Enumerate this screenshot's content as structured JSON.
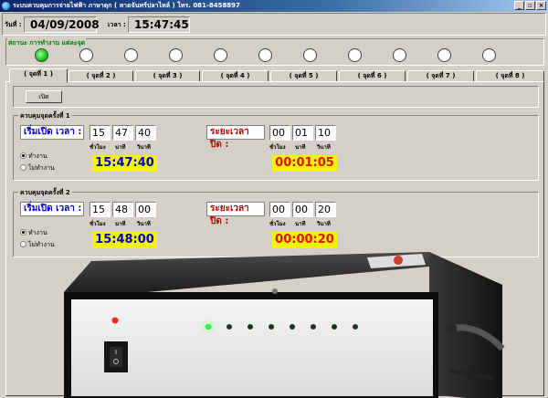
{
  "window": {
    "title": "ระบบควบคุมการจ่ายไฟฟ้า ภาษาดุก ( หาดจันทร์ปลาไหล์ ) โทร. 081-8458897",
    "buttons": [
      "_",
      "▫",
      "×"
    ]
  },
  "topbar": {
    "date_label": "วันที่ :",
    "date_value": "04/09/2008",
    "time_label": "เวลา :",
    "time_value": "15:47:45"
  },
  "status": {
    "title": "สถานะ การทำงาน แต่ละจุด",
    "leds": [
      {
        "on": true
      },
      {
        "on": false
      },
      {
        "on": false
      },
      {
        "on": false
      },
      {
        "on": false
      },
      {
        "on": false
      },
      {
        "on": false
      },
      {
        "on": false
      },
      {
        "on": false
      },
      {
        "on": false
      },
      {
        "on": false
      }
    ]
  },
  "tabs": [
    "( จุดที่ 1 )",
    "( จุดที่ 2 )",
    "( จุดที่ 3 )",
    "( จุดที่ 4 )",
    "( จุดที่ 5 )",
    "( จุดที่ 6 )",
    "( จุดที่ 7 )",
    "( จุดที่ 8 )"
  ],
  "open_button": "เปิด",
  "groups": [
    {
      "title": "ควบคุมจุดครั้งที่ 1",
      "start_caption": "เริ่มเปิด เวลา :",
      "start": {
        "h": "15",
        "m": "47",
        "s": "40"
      },
      "duration_caption": "ระยะเวลา ปิด :",
      "duration": {
        "h": "00",
        "m": "01",
        "s": "10"
      },
      "units": {
        "h": "ชั่วโมง",
        "m": "นาที",
        "s": "วินาที"
      },
      "radio_on": "ทำงาน",
      "radio_off": "ไม่ทำงาน",
      "start_display": "15:47:40",
      "duration_display": "00:01:05"
    },
    {
      "title": "ควบคุมจุดครั้งที่ 2",
      "start_caption": "เริ่มเปิด เวลา :",
      "start": {
        "h": "15",
        "m": "48",
        "s": "00"
      },
      "duration_caption": "ระยะเวลา ปิด :",
      "duration": {
        "h": "00",
        "m": "00",
        "s": "20"
      },
      "units": {
        "h": "ชั่วโมง",
        "m": "นาที",
        "s": "วินาที"
      },
      "radio_on": "ทำงาน",
      "radio_off": "ไม่ทำงาน",
      "start_display": "15:48:00",
      "duration_display": "00:00:20"
    }
  ],
  "colors": {
    "led_on": "#10c810",
    "start_text": "#0000c8",
    "duration_text": "#e01000",
    "display_bg": "#f5f500",
    "status_title": "#008000"
  }
}
